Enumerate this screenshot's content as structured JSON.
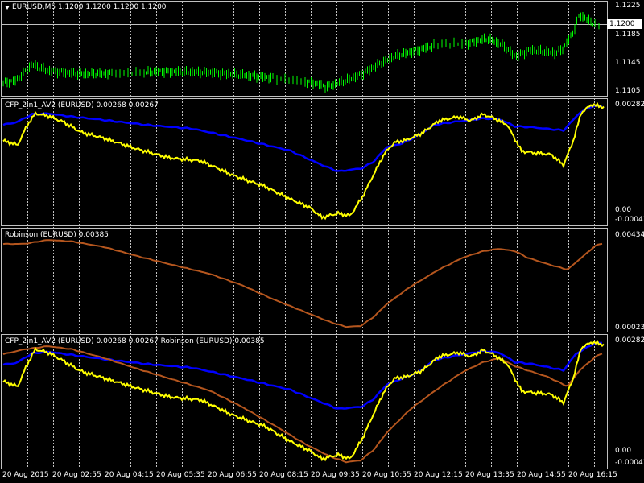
{
  "panels": {
    "main": {
      "title": "EURUSD,M5  1.1200 1.1200 1.1200 1.1200",
      "price_box": "1.1200",
      "axis_labels": [
        "1.1225",
        "1.1185",
        "1.1145",
        "1.1105"
      ]
    },
    "ind1": {
      "title": "CFP_2in1_AV2 (EURUSD) 0.00268 0.00267",
      "axis_top": "0.00282",
      "axis_zero": "0.00",
      "axis_bottom": "-0.00043"
    },
    "ind2": {
      "title": "Robinson (EURUSD) 0.00385",
      "axis_top": "0.00434",
      "axis_bottom": "0.00023"
    },
    "ind3": {
      "title": "CFP_2in1_AV2 (EURUSD) 0.00268 0.00267  Robinson (EURUSD) 0.00385",
      "axis_top": "0.00282",
      "axis_zero": "0.00",
      "axis_bottom": "-0.00043"
    }
  },
  "time_axis": [
    "20 Aug 2015",
    "20 Aug 02:55",
    "20 Aug 04:15",
    "20 Aug 05:35",
    "20 Aug 06:55",
    "20 Aug 08:15",
    "20 Aug 09:35",
    "20 Aug 10:55",
    "20 Aug 12:15",
    "20 Aug 13:35",
    "20 Aug 14:55",
    "20 Aug 16:15"
  ],
  "colors": {
    "background": "#000000",
    "candles": "#00ff00",
    "blue_line": "#0000ff",
    "yellow_line": "#ffff00",
    "robinson_line": "#b5561e",
    "grid": "#c0c0c0"
  }
}
